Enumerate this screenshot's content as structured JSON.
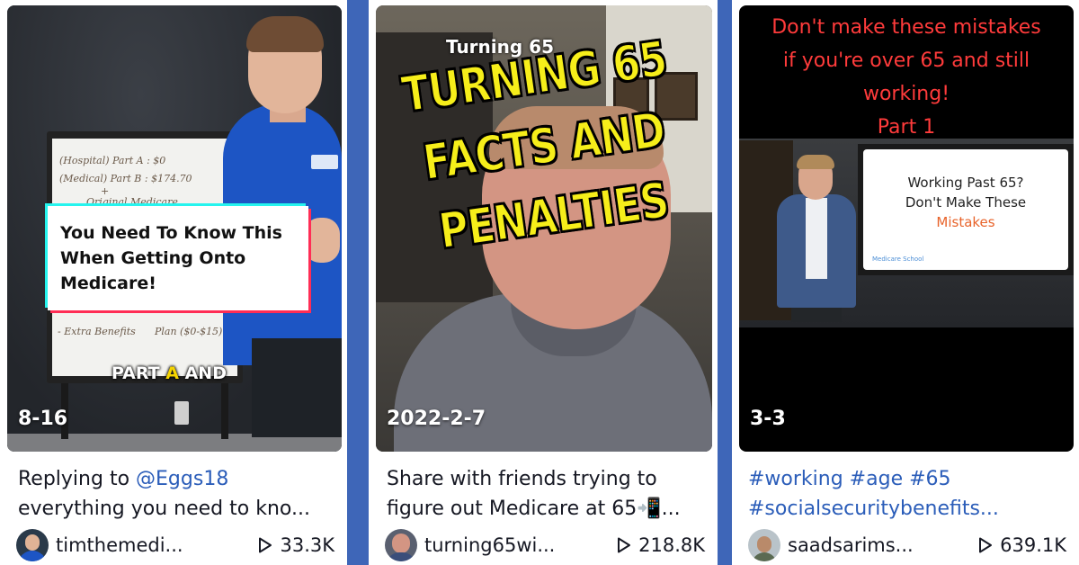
{
  "cards": [
    {
      "date": "8-16",
      "desc_prefix": "Replying to ",
      "desc_mention": "@Eggs18",
      "desc_line2": "everything you need to kno...",
      "username": "timthemedi...",
      "views": "33.3K",
      "thumb": {
        "caption": "You Need To Know This When Getting Onto Medicare!",
        "subtitle_a": "PART ",
        "subtitle_hl": "A",
        "subtitle_b": " AND",
        "board_lines": [
          "(Hospital) Part A : $0",
          "(Medical) Part B : $174.70",
          "+",
          "Original Medicare",
          "- Extra Benefits",
          "Plan ($0-$15)"
        ]
      }
    },
    {
      "date": "2022-2-7",
      "desc_line1": "Share with friends trying to",
      "desc_line2": "figure out Medicare at 65📲...",
      "username": "turning65wi...",
      "views": "218.8K",
      "thumb": {
        "top_text": "Turning 65",
        "big_line1": "TURNING 65",
        "big_line2": "FACTS AND",
        "big_line3": "PENALTIES"
      }
    },
    {
      "date": "3-3",
      "desc_line1": "#working #age #65",
      "desc_line2": "#socialsecuritybenefits...",
      "username": "saadsarims...",
      "views": "639.1K",
      "thumb": {
        "title_line1": "Don't make these mistakes",
        "title_line2": "if you're over 65 and still",
        "title_line3": "working!",
        "title_line4": "Part 1",
        "screen_line1": "Working Past 65?",
        "screen_line2": "Don't Make These",
        "screen_line3": "Mistakes",
        "screen_brand": "Medicare School"
      }
    }
  ],
  "colors": {
    "background": "#3e66b8",
    "link": "#2b5db9",
    "text": "#161823",
    "caption_title_red": "#ff3b3b",
    "highlight_yellow": "#f6ee1a"
  },
  "icons": {
    "views": "play-outline-icon"
  }
}
